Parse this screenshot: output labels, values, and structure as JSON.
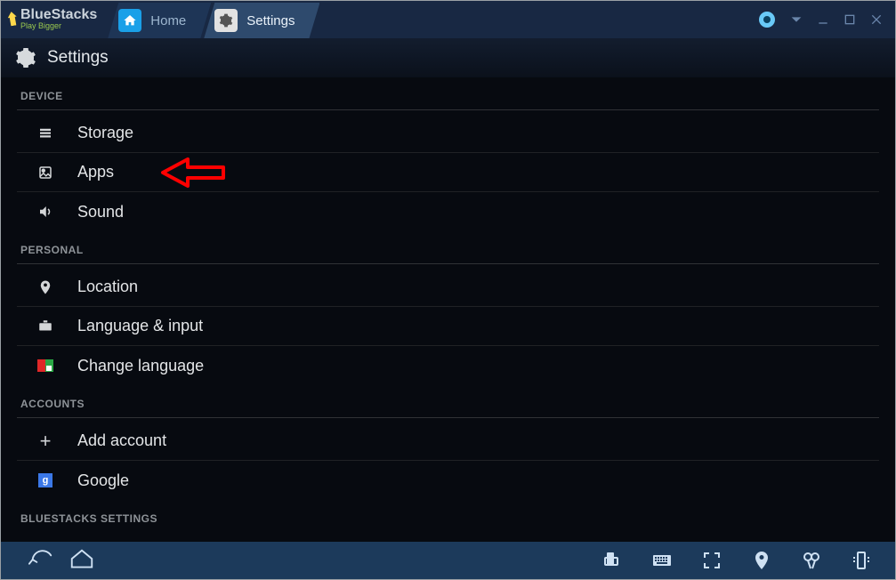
{
  "logo": {
    "name": "BlueStacks",
    "tagline": "Play Bigger"
  },
  "tabs": [
    {
      "key": "home",
      "label": "Home",
      "active": false
    },
    {
      "key": "settings",
      "label": "Settings",
      "active": true
    }
  ],
  "page": {
    "title": "Settings"
  },
  "sections": [
    {
      "key": "device",
      "title": "DEVICE",
      "items": [
        {
          "key": "storage",
          "label": "Storage",
          "icon": "storage"
        },
        {
          "key": "apps",
          "label": "Apps",
          "icon": "apps",
          "callout": true
        },
        {
          "key": "sound",
          "label": "Sound",
          "icon": "sound"
        }
      ]
    },
    {
      "key": "personal",
      "title": "PERSONAL",
      "items": [
        {
          "key": "location",
          "label": "Location",
          "icon": "location"
        },
        {
          "key": "language",
          "label": "Language & input",
          "icon": "keyboard"
        },
        {
          "key": "change-lang",
          "label": "Change language",
          "icon": "flag"
        }
      ]
    },
    {
      "key": "accounts",
      "title": "ACCOUNTS",
      "items": [
        {
          "key": "add-account",
          "label": "Add account",
          "icon": "plus"
        },
        {
          "key": "google",
          "label": "Google",
          "icon": "google"
        }
      ]
    },
    {
      "key": "bluestacks",
      "title": "BLUESTACKS SETTINGS",
      "items": []
    }
  ]
}
